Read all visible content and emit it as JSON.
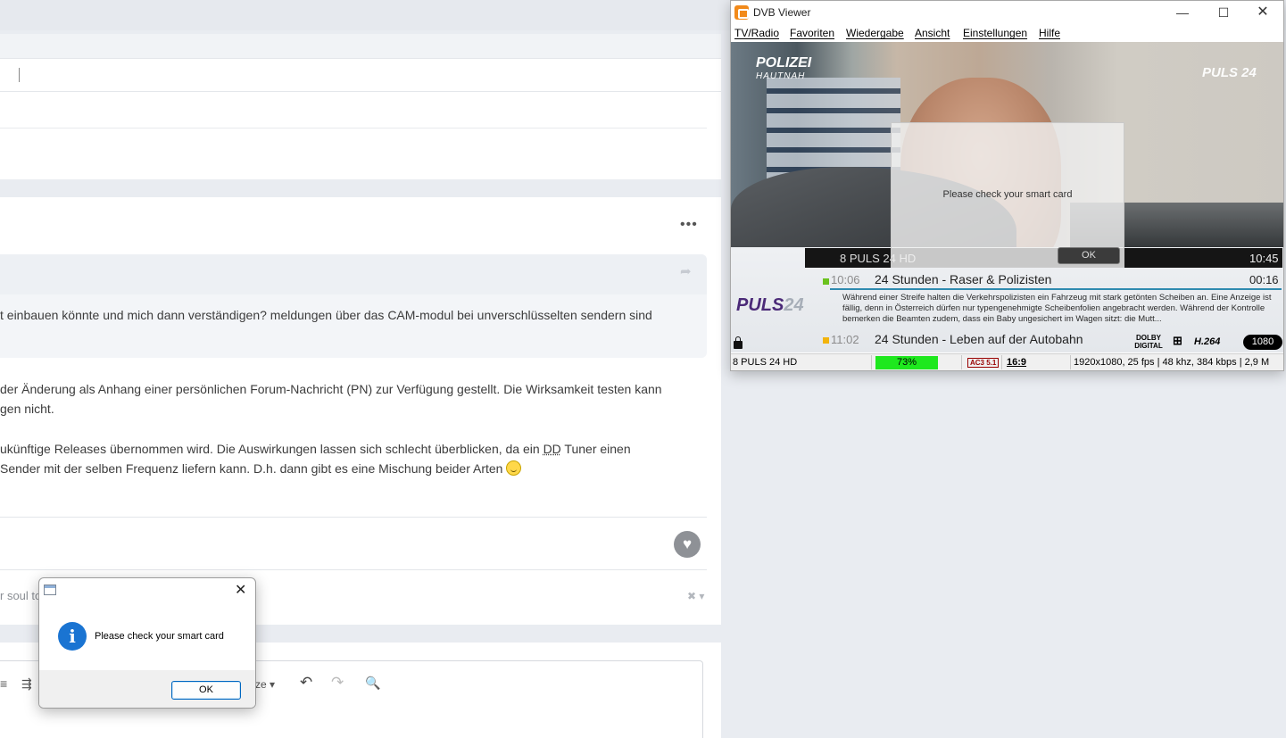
{
  "forum": {
    "quote_text": "t einbauen könnte und mich dann verständigen? meldungen über das CAM-modul bei unverschlüsselten sendern sind",
    "para1_line1": "der Änderung als Anhang einer persönlichen Forum-Nachricht (PN) zur Verfügung gestellt. Die Wirksamkeit testen kann",
    "para1_line2": "gen nicht.",
    "para2_line1_a": "ukünftige Releases übernommen wird. Die Auswirkungen lassen sich schlecht überblicken, da ein ",
    "para2_line1_abbr": "DD",
    "para2_line1_b": " Tuner einen",
    "para2_line2": " Sender mit der selben Frequenz liefern kann. D.h. dann gibt es eine Mischung beider Arten",
    "signature": "r soul to",
    "toolbar_size_label": "ze"
  },
  "dvb": {
    "title": "DVB Viewer",
    "menu": [
      "TV/Radio",
      "Favoriten",
      "Wiedergabe",
      "Ansicht",
      "Einstellungen",
      "Hilfe"
    ],
    "logo_show": "POLIZEI",
    "logo_show_sub": "HAUTNAH",
    "logo_channel": "PULS 24",
    "osd_channel": "8 PULS 24 HD",
    "osd_clock": "10:45",
    "epg_logo": "PULS",
    "epg_logo_num": "24",
    "now": {
      "start": "10:06",
      "title": "24 Stunden - Raser & Polizisten",
      "end": "00:16",
      "dot_color": "#6bc21e"
    },
    "now_desc": "Während einer Streife halten die Verkehrspolizisten ein Fahrzeug mit stark getönten Scheiben an. Eine Anzeige ist fällig, denn in Österreich dürfen nur typengenehmigte Scheibenfolien angebracht werden. Während der Kontrolle bemerken die Beamten zudem, dass ein Baby ungesichert im Wagen sitzt: die Mutt...",
    "next": {
      "start": "11:02",
      "title": "24 Stunden - Leben auf der Autobahn",
      "dot_color": "#f2b40c"
    },
    "badges": [
      "DOLBY DIGITAL",
      "H.264",
      "1080"
    ],
    "status": {
      "channel": "8 PULS 24 HD",
      "signal": "73%",
      "signal_fraction": 0.73,
      "audio": "AC3 5.1",
      "aspect": "16:9",
      "info": "1920x1080, 25 fps | 48 khz, 384 kbps | 2,9 M"
    },
    "dialog": {
      "message": "Please check your smart card",
      "ok": "OK"
    }
  },
  "msgbox": {
    "message": "Please check your smart card",
    "ok": "OK"
  },
  "colors": {
    "signal_green": "#1ee81e",
    "info_blue": "#1a74d2",
    "epg_progress": "#2f8bb0"
  }
}
